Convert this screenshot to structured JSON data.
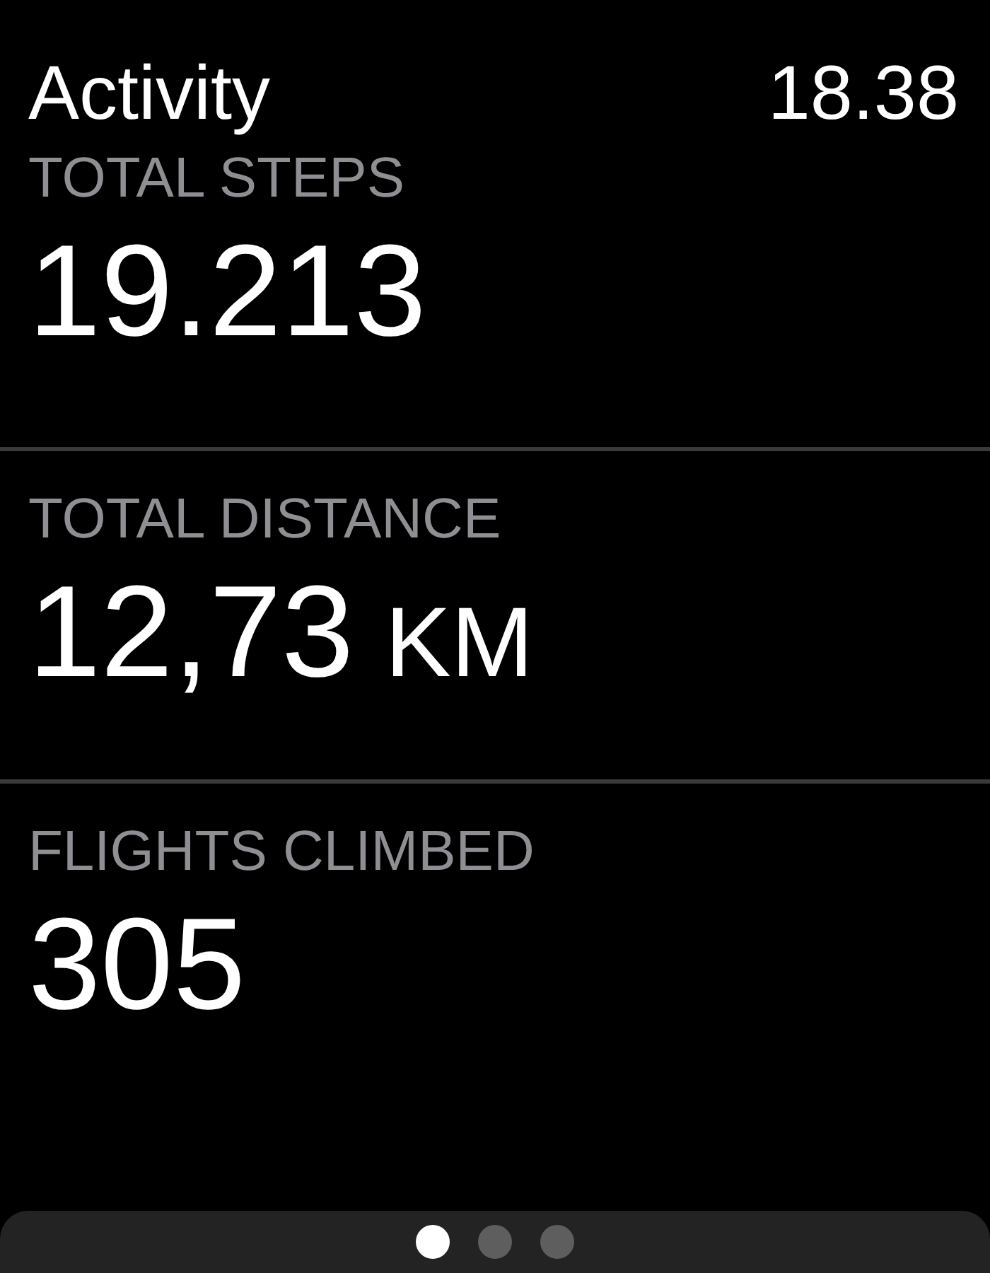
{
  "header": {
    "title": "Activity",
    "time": "18.38"
  },
  "metrics": [
    {
      "label": "TOTAL STEPS",
      "value": "19.213"
    },
    {
      "label": "TOTAL DISTANCE",
      "value": "12,73",
      "unit": "KM"
    },
    {
      "label": "FLIGHTS CLIMBED",
      "value": "305"
    }
  ],
  "page_indicator": [
    {
      "selected": true
    },
    {
      "selected": false
    },
    {
      "selected": false
    }
  ]
}
